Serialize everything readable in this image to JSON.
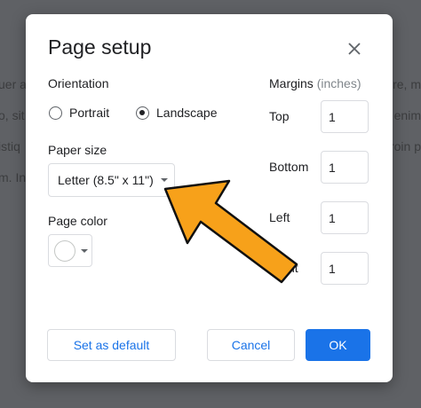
{
  "background": {
    "left_lines": [
      "uer a",
      "o, sit",
      "istiq",
      "m. In"
    ],
    "right_lines": [
      "re, m",
      "enim",
      "roin p"
    ]
  },
  "dialog": {
    "title": "Page setup",
    "close_icon": "close-icon",
    "orientation": {
      "label": "Orientation",
      "options": [
        {
          "label": "Portrait",
          "checked": false
        },
        {
          "label": "Landscape",
          "checked": true
        }
      ]
    },
    "paper_size": {
      "label": "Paper size",
      "value": "Letter (8.5\" x 11\")"
    },
    "page_color": {
      "label": "Page color",
      "value": "#ffffff"
    },
    "margins": {
      "label": "Margins",
      "unit": "(inches)",
      "fields": [
        {
          "label": "Top",
          "value": "1"
        },
        {
          "label": "Bottom",
          "value": "1"
        },
        {
          "label": "Left",
          "value": "1"
        },
        {
          "label": "Right",
          "value": "1"
        }
      ]
    },
    "buttons": {
      "set_default": "Set as default",
      "cancel": "Cancel",
      "ok": "OK"
    }
  },
  "colors": {
    "accent": "#1a73e8",
    "arrow": "#f7a11a"
  }
}
